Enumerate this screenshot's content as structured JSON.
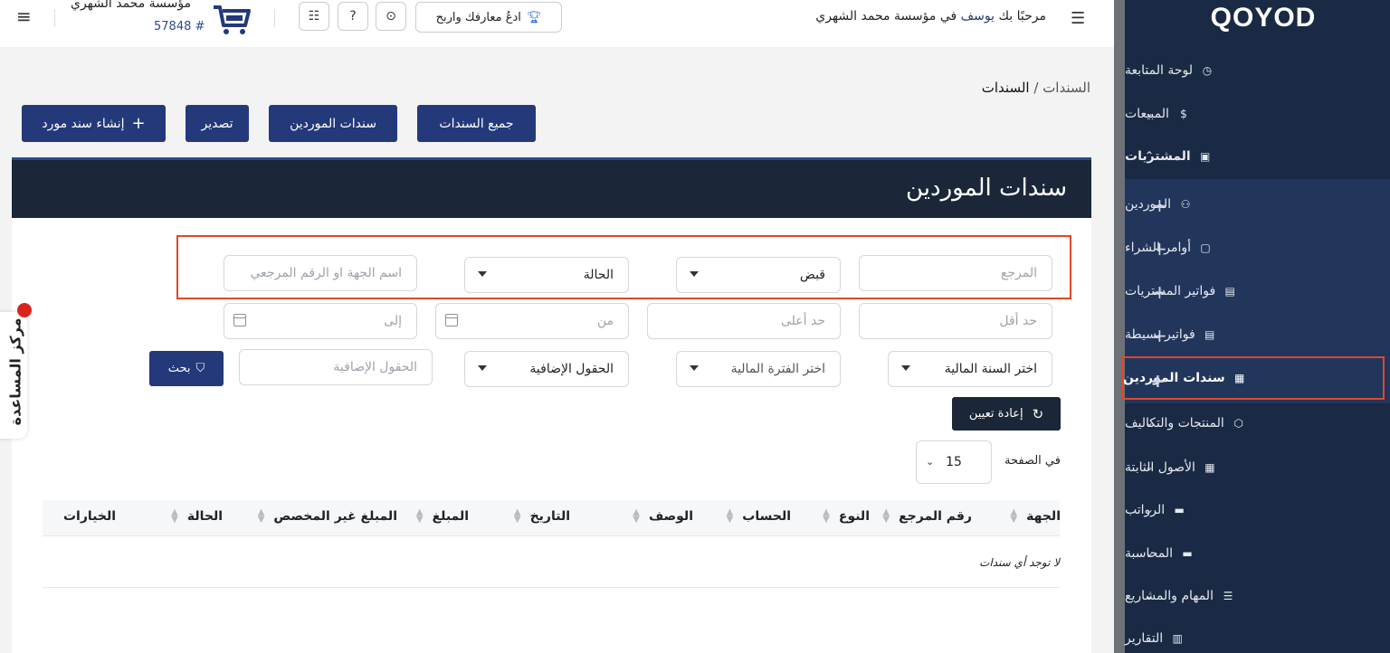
{
  "topbar": {
    "welcome_prefix": "مرحبًا بك",
    "user_name": "يوسف",
    "welcome_suffix": "في مؤسسة محمد الشهري",
    "learn_earn_label": "ادعُ معارفك واربح",
    "company_name": "مؤسسة محمد الشهري",
    "company_id": "57848 #"
  },
  "sidebar": {
    "logo": "QOYOD",
    "items": [
      {
        "label": "لوحة المتابعة",
        "icon": "dashboard-icon"
      },
      {
        "label": "المبيعات",
        "icon": "dollar-icon"
      },
      {
        "label": "المشتريات",
        "icon": "purchase-icon"
      },
      {
        "label": "المنتجات والتكاليف",
        "icon": "box-icon"
      },
      {
        "label": "الأصول الثابتة",
        "icon": "grid-icon"
      },
      {
        "label": "الرواتب",
        "icon": "folder-icon"
      },
      {
        "label": "المحاسبة",
        "icon": "folder-icon"
      },
      {
        "label": "المهام والمشاريع",
        "icon": "tasks-icon"
      },
      {
        "label": "التقارير",
        "icon": "report-icon"
      }
    ],
    "sub_items": [
      {
        "label": "الموردين",
        "icon": "suppliers-icon"
      },
      {
        "label": "أوامر الشراء",
        "icon": "order-icon"
      },
      {
        "label": "فواتير المشتريات",
        "icon": "invoice-icon"
      },
      {
        "label": "فواتير بسيطة",
        "icon": "invoice-icon"
      },
      {
        "label": "سندات الموردين",
        "icon": "voucher-icon"
      }
    ]
  },
  "breadcrumb": {
    "parent": "السندات",
    "separator": "/",
    "current": "السندات"
  },
  "actions": {
    "all_vouchers": "جميع السندات",
    "supplier_vouchers": "سندات الموردين",
    "export": "تصدير",
    "create": "إنشاء سند مورد"
  },
  "card": {
    "title": "سندات الموردين"
  },
  "filters": {
    "reference_placeholder": "المرجع",
    "type_value": "قبض",
    "status_value": "الحالة",
    "party_placeholder": "اسم الجهة او الرقم المرجعي",
    "min_placeholder": "حد أقل",
    "max_placeholder": "حد أعلى",
    "from_placeholder": "من",
    "to_placeholder": "إلى",
    "fiscal_year_value": "اختر السنة المالية",
    "fiscal_period_value": "اختر الفترة المالية",
    "extra_fields_value": "الحقول الإضافية",
    "extra_fields_placeholder": "الحقول الإضافية",
    "search_label": "بحث",
    "reset_label": "إعادة تعيين",
    "per_page_label": "في الصفحة",
    "per_page_value": "15"
  },
  "table": {
    "columns": [
      "الجهة",
      "رقم المرجع",
      "النوع",
      "الحساب",
      "الوصف",
      "التاريخ",
      "المبلغ",
      "المبلغ غير المخصص",
      "الحالة",
      "الخيارات"
    ],
    "empty_message": "لا توجد أي سندات"
  },
  "help_center": {
    "label": "مركز المساعدة"
  }
}
